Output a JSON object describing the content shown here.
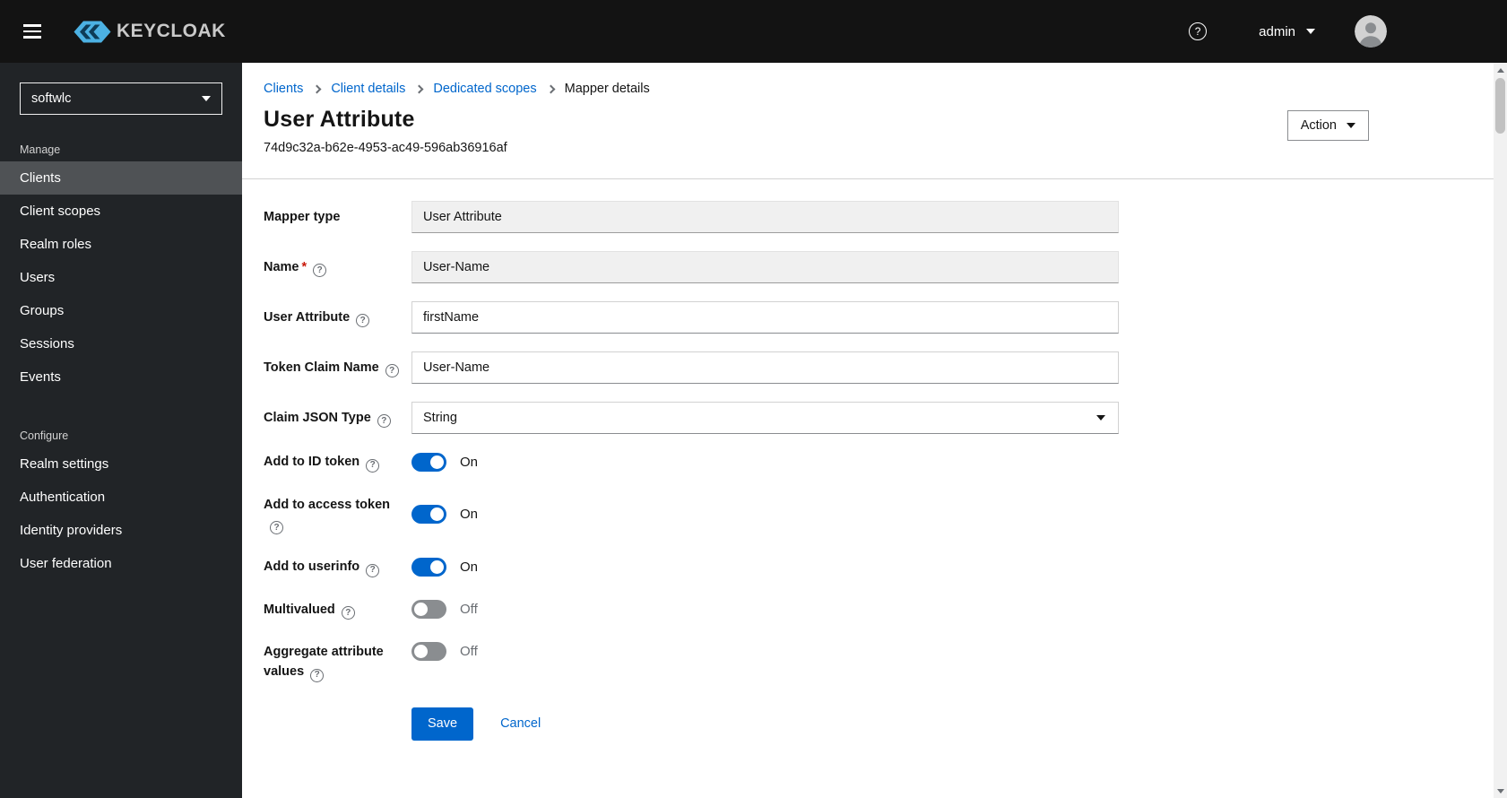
{
  "header": {
    "brand": "KEYCLOAK",
    "user_menu": {
      "label": "admin"
    }
  },
  "sidebar": {
    "realm_selector": {
      "value": "softwlc"
    },
    "sections": [
      {
        "label": "Manage",
        "items": [
          {
            "label": "Clients"
          },
          {
            "label": "Client scopes"
          },
          {
            "label": "Realm roles"
          },
          {
            "label": "Users"
          },
          {
            "label": "Groups"
          },
          {
            "label": "Sessions"
          },
          {
            "label": "Events"
          }
        ]
      },
      {
        "label": "Configure",
        "items": [
          {
            "label": "Realm settings"
          },
          {
            "label": "Authentication"
          },
          {
            "label": "Identity providers"
          },
          {
            "label": "User federation"
          }
        ]
      }
    ]
  },
  "breadcrumb": {
    "items": [
      "Clients",
      "Client details",
      "Dedicated scopes",
      "Mapper details"
    ]
  },
  "page": {
    "title": "User Attribute",
    "id": "74d9c32a-b62e-4953-ac49-596ab36916af",
    "action_button": "Action"
  },
  "form": {
    "mapper_type": {
      "label": "Mapper type",
      "value": "User Attribute"
    },
    "name": {
      "label": "Name",
      "required_marker": "*",
      "value": "User-Name"
    },
    "user_attribute": {
      "label": "User Attribute",
      "value": "firstName"
    },
    "token_claim_name": {
      "label": "Token Claim Name",
      "value": "User-Name"
    },
    "claim_json_type": {
      "label": "Claim JSON Type",
      "value": "String"
    },
    "add_to_id_token": {
      "label": "Add to ID token",
      "state": "On"
    },
    "add_to_access_token": {
      "label": "Add to access token",
      "state": "On"
    },
    "add_to_userinfo": {
      "label": "Add to userinfo",
      "state": "On"
    },
    "multivalued": {
      "label": "Multivalued",
      "state": "Off"
    },
    "aggregate_attribute_values": {
      "label": "Aggregate attribute values",
      "state": "Off"
    },
    "save_button": "Save",
    "cancel_button": "Cancel"
  },
  "colors": {
    "primary": "#0066cc",
    "header_bg": "#131313",
    "sidebar_bg": "#212427",
    "sidebar_active_bg": "#4f5255",
    "toggle_on": "#0066cc",
    "toggle_off": "#8a8d90",
    "link": "#0066cc",
    "required": "#c9190b"
  }
}
